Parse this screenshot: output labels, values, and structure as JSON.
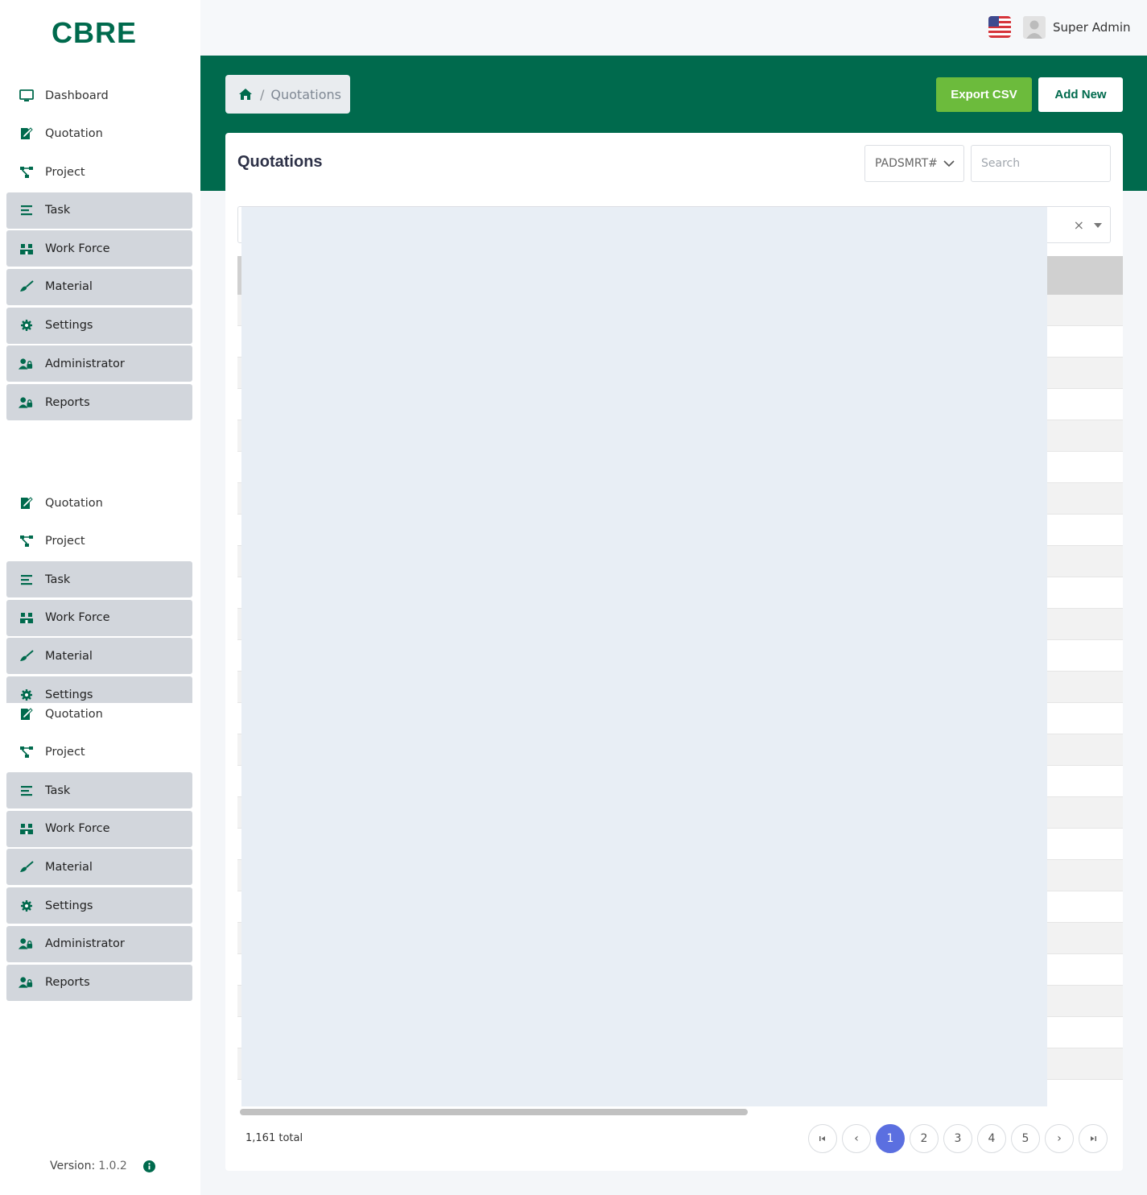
{
  "brand": {
    "logo_text": "CBRE",
    "color": "#006a4d",
    "accent": "#6cbb3c"
  },
  "sidebar": {
    "block1": [
      {
        "label": "Dashboard",
        "icon": "monitor-icon",
        "boxed": false
      },
      {
        "label": "Quotation",
        "icon": "edit-document-icon",
        "boxed": false
      },
      {
        "label": "Project",
        "icon": "sitemap-icon",
        "boxed": false
      },
      {
        "label": "Task",
        "icon": "list-icon",
        "boxed": true
      },
      {
        "label": "Work Force",
        "icon": "workforce-icon",
        "boxed": true
      },
      {
        "label": "Material",
        "icon": "brush-icon",
        "boxed": true
      },
      {
        "label": "Settings",
        "icon": "gear-icon",
        "boxed": true
      },
      {
        "label": "Administrator",
        "icon": "user-lock-icon",
        "boxed": true
      },
      {
        "label": "Reports",
        "icon": "user-lock-icon",
        "boxed": true
      }
    ],
    "block2": [
      {
        "label": "Quotation",
        "icon": "edit-document-icon",
        "boxed": false
      },
      {
        "label": "Project",
        "icon": "sitemap-icon",
        "boxed": false
      },
      {
        "label": "Task",
        "icon": "list-icon",
        "boxed": true
      },
      {
        "label": "Work Force",
        "icon": "workforce-icon",
        "boxed": true
      },
      {
        "label": "Material",
        "icon": "brush-icon",
        "boxed": true
      },
      {
        "label": "Settings",
        "icon": "gear-icon",
        "boxed": true
      }
    ],
    "block3": [
      {
        "label": "Quotation",
        "icon": "edit-document-icon",
        "boxed": false
      },
      {
        "label": "Project",
        "icon": "sitemap-icon",
        "boxed": false
      },
      {
        "label": "Task",
        "icon": "list-icon",
        "boxed": true
      },
      {
        "label": "Work Force",
        "icon": "workforce-icon",
        "boxed": true
      },
      {
        "label": "Material",
        "icon": "brush-icon",
        "boxed": true
      },
      {
        "label": "Settings",
        "icon": "gear-icon",
        "boxed": true
      },
      {
        "label": "Administrator",
        "icon": "user-lock-icon",
        "boxed": true
      },
      {
        "label": "Reports",
        "icon": "user-lock-icon",
        "boxed": true
      }
    ],
    "version_label": "Version:",
    "version_number": "1.0.2"
  },
  "topbar": {
    "username": "Super Admin"
  },
  "header": {
    "breadcrumb": "Quotations",
    "export_label": "Export CSV",
    "add_label": "Add New"
  },
  "card": {
    "title": "Quotations",
    "filter_select": "PADSMRT#",
    "search_placeholder": "Search",
    "clear_symbol": "×"
  },
  "pagination": {
    "total": "1,161 total",
    "pages": [
      "1",
      "2",
      "3",
      "4",
      "5"
    ],
    "active_page": "1",
    "first_symbol": "⏮",
    "prev_symbol": "‹",
    "next_symbol": "›",
    "last_symbol": "⏭"
  }
}
